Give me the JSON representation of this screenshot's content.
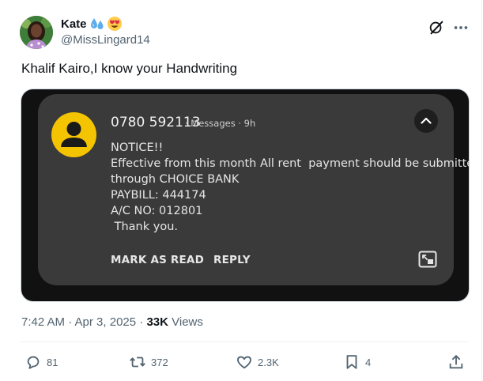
{
  "author": {
    "display_name": "Kate",
    "emojis": [
      "sweat-droplets-emoji",
      "heart-eyes-emoji"
    ],
    "handle": "@MissLingard14"
  },
  "tweet": {
    "text": "Khalif Kairo,I know your Handwriting"
  },
  "notification": {
    "sender": "0780 592113",
    "meta": "· Messages · 9h",
    "lines": [
      "NOTICE!!",
      "Effective from this month All rent  payment should be submitted",
      "through CHOICE BANK",
      "PAYBILL: 444174",
      "A/C NO: 012801",
      " Thank you."
    ],
    "actions": {
      "mark_as_read": "MARK AS READ",
      "reply": "REPLY"
    },
    "colors": {
      "avatar": "#f5c400",
      "card": "#3a3a3a",
      "background": "#111111"
    }
  },
  "timestamp": {
    "time_date": "7:42 AM · Apr 3, 2025 · ",
    "views_count": "33K",
    "views_label": " Views"
  },
  "engagement": {
    "replies": "81",
    "reposts": "372",
    "likes": "2.3K",
    "bookmarks": "4"
  },
  "icons": {
    "header": [
      "grok-icon",
      "more-icon"
    ],
    "actions": [
      "reply-icon",
      "repost-icon",
      "like-icon",
      "bookmark-icon",
      "share-icon"
    ]
  }
}
